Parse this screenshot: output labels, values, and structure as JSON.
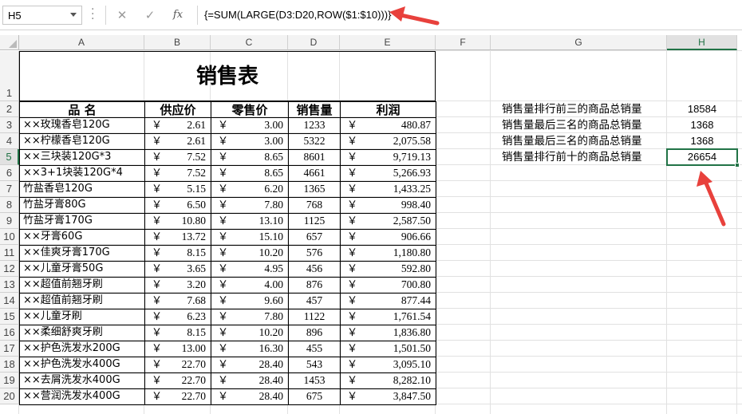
{
  "formula_bar": {
    "name_box": "H5",
    "cancel_icon": "✕",
    "enter_icon": "✓",
    "fx_label": "fx",
    "formula": "{=SUM(LARGE(D3:D20,ROW($1:$10)))}"
  },
  "columns": [
    "A",
    "B",
    "C",
    "D",
    "E",
    "F",
    "G",
    "H"
  ],
  "rows": [
    "1",
    "2",
    "3",
    "4",
    "5",
    "6",
    "7",
    "8",
    "9",
    "10",
    "11",
    "12",
    "13",
    "14",
    "15",
    "16",
    "17",
    "18",
    "19",
    "20"
  ],
  "active_cell": {
    "column": "H",
    "row": "5"
  },
  "sheet": {
    "title": "销售表",
    "headers": [
      "品 名",
      "供应价",
      "零售价",
      "销售量",
      "利润"
    ],
    "currency_symbol": "￥",
    "products": [
      {
        "name": "××玫瑰香皂120G",
        "supply": "2.61",
        "retail": "3.00",
        "qty": "1233",
        "profit": "480.87"
      },
      {
        "name": "××柠檬香皂120G",
        "supply": "2.61",
        "retail": "3.00",
        "qty": "5322",
        "profit": "2,075.58"
      },
      {
        "name": "××三块装120G*3",
        "supply": "7.52",
        "retail": "8.65",
        "qty": "8601",
        "profit": "9,719.13"
      },
      {
        "name": "××3+1块装120G*4",
        "supply": "7.52",
        "retail": "8.65",
        "qty": "4661",
        "profit": "5,266.93"
      },
      {
        "name": "竹盐香皂120G",
        "supply": "5.15",
        "retail": "6.20",
        "qty": "1365",
        "profit": "1,433.25"
      },
      {
        "name": "竹盐牙膏80G",
        "supply": "6.50",
        "retail": "7.80",
        "qty": "768",
        "profit": "998.40"
      },
      {
        "name": "竹盐牙膏170G",
        "supply": "10.80",
        "retail": "13.10",
        "qty": "1125",
        "profit": "2,587.50"
      },
      {
        "name": "××牙膏60G",
        "supply": "13.72",
        "retail": "15.10",
        "qty": "657",
        "profit": "906.66"
      },
      {
        "name": "××佳爽牙膏170G",
        "supply": "8.15",
        "retail": "10.20",
        "qty": "576",
        "profit": "1,180.80"
      },
      {
        "name": "××儿童牙膏50G",
        "supply": "3.65",
        "retail": "4.95",
        "qty": "456",
        "profit": "592.80"
      },
      {
        "name": "××超值前翘牙刷",
        "supply": "3.20",
        "retail": "4.00",
        "qty": "876",
        "profit": "700.80"
      },
      {
        "name": "××超值前翘牙刷",
        "supply": "7.68",
        "retail": "9.60",
        "qty": "457",
        "profit": "877.44"
      },
      {
        "name": "××儿童牙刷",
        "supply": "6.23",
        "retail": "7.80",
        "qty": "1122",
        "profit": "1,761.54"
      },
      {
        "name": "××柔细舒爽牙刷",
        "supply": "8.15",
        "retail": "10.20",
        "qty": "896",
        "profit": "1,836.80"
      },
      {
        "name": "××护色洗发水200G",
        "supply": "13.00",
        "retail": "16.30",
        "qty": "455",
        "profit": "1,501.50"
      },
      {
        "name": "××护色洗发水400G",
        "supply": "22.70",
        "retail": "28.40",
        "qty": "543",
        "profit": "3,095.10"
      },
      {
        "name": "××去屑洗发水400G",
        "supply": "22.70",
        "retail": "28.40",
        "qty": "1453",
        "profit": "8,282.10"
      },
      {
        "name": "××营润洗发水400G",
        "supply": "22.70",
        "retail": "28.40",
        "qty": "675",
        "profit": "3,847.50"
      }
    ],
    "summary": [
      {
        "label": "销售量排行前三的商品总销量",
        "value": "18584"
      },
      {
        "label": "销售量最后三名的商品总销量",
        "value": "1368"
      },
      {
        "label": "销售量最后三名的商品总销量",
        "value": "1368"
      },
      {
        "label": "销售量排行前十的商品总销量",
        "value": "26654"
      }
    ]
  },
  "colors": {
    "accent": "#217346",
    "annotation_arrow": "#e8413c"
  }
}
